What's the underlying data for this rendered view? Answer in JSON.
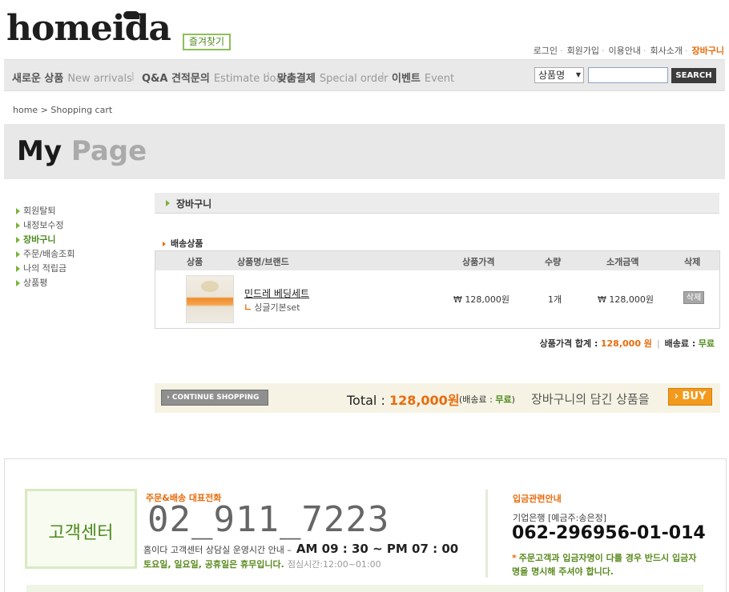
{
  "header": {
    "logo_text": "homeida",
    "favorite_label": "즐겨찾기",
    "top_links": [
      {
        "label": "로그인"
      },
      {
        "label": "회원가입"
      },
      {
        "label": "이용안내"
      },
      {
        "label": "회사소개"
      },
      {
        "label": "장바구니"
      }
    ]
  },
  "gnb": {
    "items": [
      {
        "ko": "새로운 상품",
        "en": "New arrivals"
      },
      {
        "ko": "Q&A 견적문의",
        "en": "Estimate board"
      },
      {
        "ko": "맞춤결제",
        "en": "Special order"
      },
      {
        "ko": "이벤트",
        "en": "Event"
      }
    ],
    "search": {
      "select_value": "상품명",
      "input_value": "",
      "button_label": "SEARCH"
    }
  },
  "breadcrumb": "home > Shopping cart",
  "page_title": {
    "my": "My",
    "page": "Page"
  },
  "sidebar": {
    "items": [
      {
        "label": "회원탈퇴"
      },
      {
        "label": "내정보수정"
      },
      {
        "label": "장바구니"
      },
      {
        "label": "주문/배송조회"
      },
      {
        "label": "나의 적립금"
      },
      {
        "label": "상품평"
      }
    ]
  },
  "cart": {
    "section_title": "장바구니",
    "delivery_title": "배송상품",
    "headers": {
      "image": "상품",
      "name": "상품명/브랜드",
      "price": "상품가격",
      "qty": "수량",
      "subtotal": "소개금액",
      "delete": "삭제"
    },
    "items": [
      {
        "name": "민드레 베딩세트",
        "option": "싱글기본set",
        "price": "₩ 128,000원",
        "qty": "1개",
        "subtotal": "₩ 128,000원",
        "delete_label": "삭제"
      }
    ],
    "summary": {
      "price_label": "상품가격 합계 :",
      "price_value": "128,000 원",
      "shipping_label": "배송료 :",
      "shipping_value": "무료"
    },
    "total": {
      "continue_label": "› CONTINUE SHOPPING",
      "total_label": "Total :",
      "total_value": "128,000원",
      "ship_label": "(배송료 :",
      "ship_value": "무료",
      "ship_close": ")",
      "message": "장바구니의 담긴 상품을",
      "buy_label": "› BUY"
    }
  },
  "footer": {
    "cs_label": "고객센터",
    "rep_title": "주문&배송 대표전화",
    "rep_phone": "02_911_7223",
    "hours_label": "홈이다 고객센터 상담실 운영시간 안내  –",
    "hours_value": "AM 09 : 30 ~ PM 07 : 00",
    "holiday": "토요일, 일요일, 공휴일은 휴무입니다.",
    "lunch": "점심시간:12:00~01:00",
    "bank_title": "입금관련안내",
    "bank_name": "기업은행 [예금주:송은정]",
    "bank_account": "062-296956-01-014",
    "bank_note_star": "*",
    "bank_note": "주문고객과 입금자명이 다를 경우 반드시 입금자명을 명시해 주셔야 합니다."
  },
  "colors": {
    "accent_orange": "#e86c0c",
    "accent_green": "#78b43c",
    "buy_button": "#f39a1e"
  }
}
